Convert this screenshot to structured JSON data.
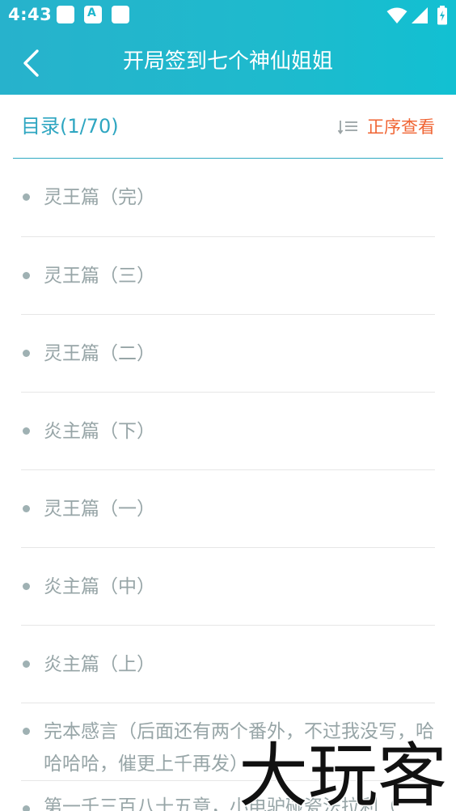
{
  "status_bar": {
    "time": "4:43",
    "notification_icons": [
      "notification-icon",
      "accessibility-icon",
      "notification-icon"
    ],
    "right_icons": [
      "wifi-icon",
      "signal-icon",
      "battery-charging-icon"
    ]
  },
  "app_bar": {
    "back_icon": "back-arrow-icon",
    "title": "开局签到七个神仙姐姐"
  },
  "directory": {
    "title": "目录(1/70)",
    "sort_icon": "sort-icon",
    "sort_label": "正序查看"
  },
  "chapters": [
    "灵王篇（完）",
    "灵王篇（三）",
    "灵王篇（二）",
    "炎主篇（下）",
    "灵王篇（一）",
    "炎主篇（中）",
    "炎主篇（上）",
    "完本感言（后面还有两个番外，不过我没写，哈哈哈哈，催更上千再发）",
    "第一千三百八十五章，小电驴碰瓷法拉利（"
  ],
  "watermark": "大玩客",
  "colors": {
    "accent": "#1ebacd",
    "directory_title": "#2ea6c1",
    "sort_label": "#f06433",
    "chapter_text": "#97a5a7"
  }
}
